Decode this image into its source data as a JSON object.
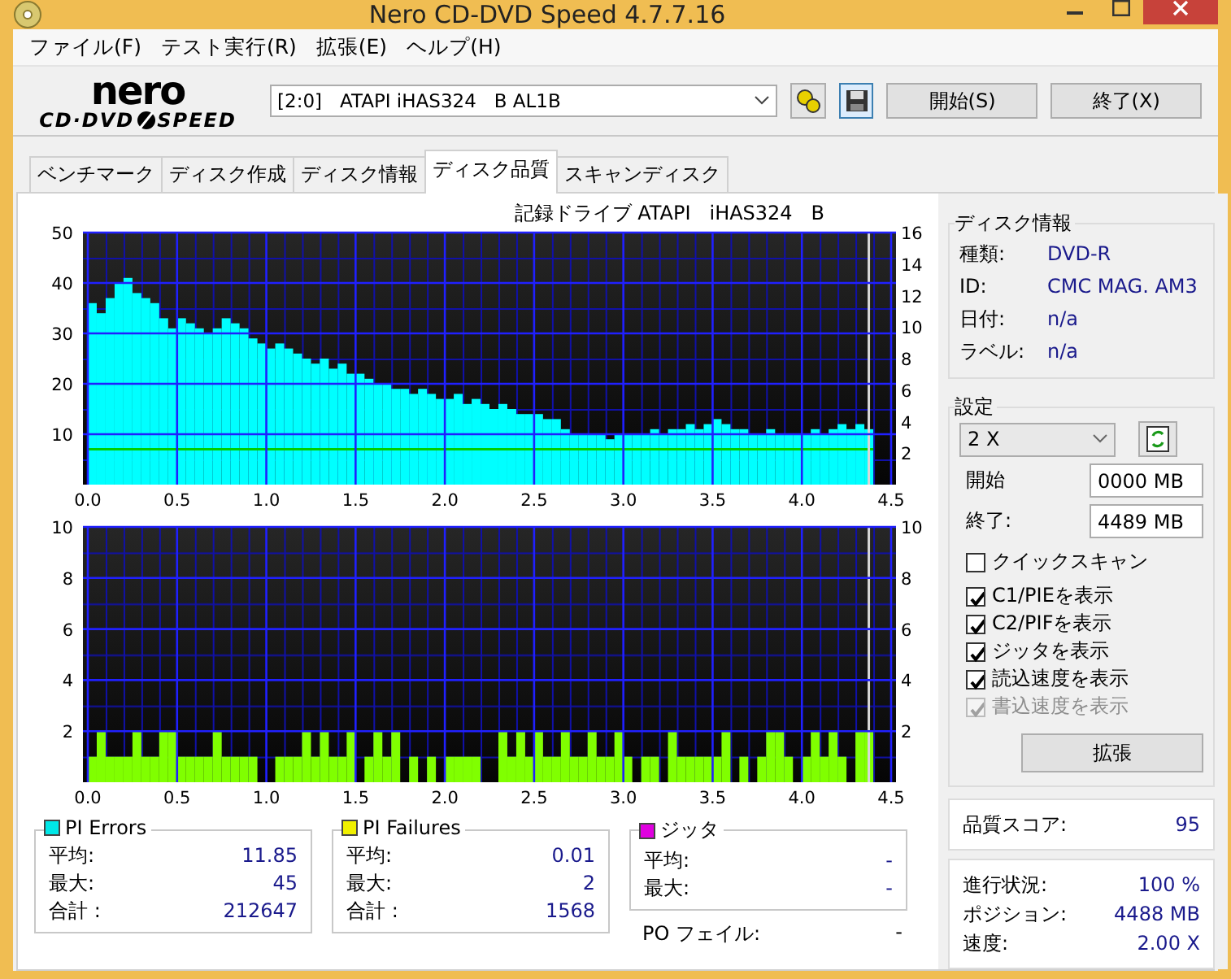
{
  "window": {
    "title": "Nero CD-DVD Speed 4.7.7.16"
  },
  "menu": [
    "ファイル(F)",
    "テスト実行(R)",
    "拡張(E)",
    "ヘルプ(H)"
  ],
  "logo": {
    "top": "nero",
    "left": "CD·DVD",
    "right": "SPEED"
  },
  "toolbar": {
    "drive": "[2:0]   ATAPI iHAS324   B AL1B",
    "buttons": [
      "開始(S)",
      "終了(X)"
    ]
  },
  "tabs": [
    {
      "label": "ベンチマーク",
      "selected": false
    },
    {
      "label": "ディスク作成",
      "selected": false
    },
    {
      "label": "ディスク情報",
      "selected": false
    },
    {
      "label": "ディスク品質",
      "selected": true
    },
    {
      "label": "スキャンディスク",
      "selected": false
    }
  ],
  "charts": [
    {
      "chart_data": {
        "type": "bar",
        "title": "記録ドライブ ATAPI   iHAS324   B",
        "xlim": [
          0,
          4.5
        ],
        "ylim": [
          0,
          50
        ],
        "y2lim": [
          0,
          16
        ],
        "xticks": [
          {
            "value": 0,
            "label": "0.0"
          },
          {
            "value": 0.5,
            "label": "0.5"
          },
          {
            "value": 1,
            "label": "1.0"
          },
          {
            "value": 1.5,
            "label": "1.5"
          },
          {
            "value": 2,
            "label": "2.0"
          },
          {
            "value": 2.5,
            "label": "2.5"
          },
          {
            "value": 3,
            "label": "3.0"
          },
          {
            "value": 3.5,
            "label": "3.5"
          },
          {
            "value": 4,
            "label": "4.0"
          },
          {
            "value": 4.5,
            "label": "4.5"
          }
        ],
        "yticks": [
          10,
          20,
          30,
          40,
          50
        ],
        "y2ticks": [
          2,
          4,
          6,
          8,
          10,
          12,
          14,
          16
        ],
        "grid": true,
        "ref_lines": [
          {
            "axis": "y",
            "value": 7,
            "color": "#00d000"
          },
          {
            "axis": "x",
            "value": 4.375,
            "color": "#d8d8d8"
          }
        ],
        "x": [
          0.025,
          0.075,
          0.125,
          0.175,
          0.225,
          0.275,
          0.325,
          0.375,
          0.425,
          0.475,
          0.525,
          0.575,
          0.625,
          0.675,
          0.725,
          0.775,
          0.825,
          0.875,
          0.925,
          0.975,
          1.025,
          1.075,
          1.125,
          1.175,
          1.225,
          1.275,
          1.325,
          1.375,
          1.425,
          1.475,
          1.525,
          1.575,
          1.625,
          1.675,
          1.725,
          1.775,
          1.825,
          1.875,
          1.925,
          1.975,
          2.025,
          2.075,
          2.125,
          2.175,
          2.225,
          2.275,
          2.325,
          2.375,
          2.425,
          2.475,
          2.525,
          2.575,
          2.625,
          2.675,
          2.725,
          2.775,
          2.825,
          2.875,
          2.925,
          2.975,
          3.025,
          3.075,
          3.125,
          3.175,
          3.225,
          3.275,
          3.325,
          3.375,
          3.425,
          3.475,
          3.525,
          3.575,
          3.625,
          3.675,
          3.725,
          3.775,
          3.825,
          3.875,
          3.925,
          3.975,
          4.025,
          4.075,
          4.125,
          4.175,
          4.225,
          4.275,
          4.325,
          4.375
        ],
        "series": [
          {
            "color": "#00ffff",
            "values": [
              36,
              34,
              37,
              40,
              41,
              38,
              37,
              36,
              33,
              31,
              33,
              32,
              31,
              30,
              31,
              33,
              32,
              31,
              29,
              28,
              27,
              28,
              27,
              26,
              25,
              24,
              25,
              23,
              24,
              22,
              22,
              21,
              20,
              20,
              19,
              19,
              18,
              19,
              18,
              17,
              17,
              18,
              16,
              17,
              16,
              15,
              16,
              15,
              14,
              14,
              14,
              13,
              13,
              11,
              10,
              10,
              10,
              10,
              9,
              10,
              10,
              10,
              10,
              11,
              10,
              11,
              11,
              12,
              11,
              12,
              13,
              12,
              11,
              11,
              10,
              10,
              11,
              10,
              10,
              10,
              10,
              11,
              10,
              11,
              12,
              11,
              12,
              11
            ]
          }
        ]
      }
    },
    {
      "chart_data": {
        "type": "bar",
        "xlim": [
          0,
          4.5
        ],
        "ylim": [
          0,
          10
        ],
        "y2lim": [
          0,
          10
        ],
        "xticks": [
          {
            "value": 0,
            "label": "0.0"
          },
          {
            "value": 0.5,
            "label": "0.5"
          },
          {
            "value": 1,
            "label": "1.0"
          },
          {
            "value": 1.5,
            "label": "1.5"
          },
          {
            "value": 2,
            "label": "2.0"
          },
          {
            "value": 2.5,
            "label": "2.5"
          },
          {
            "value": 3,
            "label": "3.0"
          },
          {
            "value": 3.5,
            "label": "3.5"
          },
          {
            "value": 4,
            "label": "4.0"
          },
          {
            "value": 4.5,
            "label": "4.5"
          }
        ],
        "yticks": [
          2,
          4,
          6,
          8,
          10
        ],
        "y2ticks": [
          2,
          4,
          6,
          8,
          10
        ],
        "grid": true,
        "ref_lines": [
          {
            "axis": "x",
            "value": 4.375,
            "color": "#d8d8d8"
          }
        ],
        "x": [
          0.025,
          0.075,
          0.125,
          0.175,
          0.225,
          0.275,
          0.325,
          0.375,
          0.425,
          0.475,
          0.525,
          0.575,
          0.625,
          0.675,
          0.725,
          0.775,
          0.825,
          0.875,
          0.925,
          1.075,
          1.125,
          1.175,
          1.225,
          1.275,
          1.325,
          1.375,
          1.425,
          1.475,
          1.575,
          1.625,
          1.675,
          1.725,
          1.825,
          1.925,
          2.025,
          2.075,
          2.125,
          2.175,
          2.325,
          2.375,
          2.425,
          2.475,
          2.525,
          2.575,
          2.625,
          2.675,
          2.725,
          2.775,
          2.825,
          2.875,
          2.925,
          2.975,
          3.025,
          3.125,
          3.175,
          3.275,
          3.325,
          3.375,
          3.425,
          3.475,
          3.525,
          3.575,
          3.675,
          3.775,
          3.825,
          3.875,
          3.925,
          4.025,
          4.075,
          4.125,
          4.175,
          4.225,
          4.325,
          4.375
        ],
        "series": [
          {
            "color": "#80ff00",
            "values": [
              1,
              2,
              1,
              1,
              1,
              2,
              1,
              1,
              2,
              2,
              1,
              1,
              1,
              1,
              2,
              1,
              1,
              1,
              1,
              1,
              1,
              1,
              2,
              1,
              2,
              1,
              1,
              2,
              1,
              2,
              1,
              2,
              1,
              1,
              1,
              1,
              1,
              1,
              2,
              1,
              2,
              1,
              2,
              1,
              1,
              2,
              1,
              1,
              2,
              1,
              1,
              2,
              1,
              1,
              1,
              2,
              1,
              1,
              1,
              1,
              1,
              2,
              1,
              1,
              2,
              2,
              1,
              1,
              2,
              1,
              2,
              1,
              2,
              2
            ]
          }
        ]
      }
    }
  ],
  "stats": [
    {
      "title": "PI Errors",
      "color": "#00e8e8",
      "rows": [
        {
          "label": "平均:",
          "value": "11.85"
        },
        {
          "label": "最大:",
          "value": "45"
        },
        {
          "label": "合計 :",
          "value": "212647"
        }
      ]
    },
    {
      "title": "PI Failures",
      "color": "#f0f000",
      "rows": [
        {
          "label": "平均:",
          "value": "0.01"
        },
        {
          "label": "最大:",
          "value": "2"
        },
        {
          "label": "合計 :",
          "value": "1568"
        }
      ]
    },
    {
      "title": "ジッタ",
      "color": "#e000e0",
      "rows": [
        {
          "label": "平均:",
          "value": "-"
        },
        {
          "label": "最大:",
          "value": "-"
        }
      ]
    }
  ],
  "po_failure": {
    "label": "PO フェイル:",
    "value": "-"
  },
  "disc_info": {
    "title": "ディスク情報",
    "rows": [
      {
        "label": "種類:",
        "value": "DVD-R"
      },
      {
        "label": "ID:",
        "value": "CMC MAG. AM3"
      },
      {
        "label": "日付:",
        "value": "n/a"
      },
      {
        "label": "ラベル:",
        "value": "n/a"
      }
    ]
  },
  "settings": {
    "title": "設定",
    "speed": "2 X",
    "start_label": "開始",
    "start": "0000 MB",
    "end_label": "終了:",
    "end": "4489 MB",
    "options": [
      {
        "label": "クイックスキャン",
        "checked": false,
        "disabled": false
      },
      {
        "label": "C1/PIEを表示",
        "checked": true,
        "disabled": false
      },
      {
        "label": "C2/PIFを表示",
        "checked": true,
        "disabled": false
      },
      {
        "label": "ジッタを表示",
        "checked": true,
        "disabled": false
      },
      {
        "label": "読込速度を表示",
        "checked": true,
        "disabled": false
      },
      {
        "label": "書込速度を表示",
        "checked": true,
        "disabled": true
      }
    ],
    "button": "拡張"
  },
  "quality": {
    "label": "品質スコア:",
    "value": "95"
  },
  "progress": [
    {
      "label": "進行状況:",
      "value": "100 %"
    },
    {
      "label": "ポジション:",
      "value": "4488 MB"
    },
    {
      "label": "速度:",
      "value": "2.00 X"
    }
  ]
}
